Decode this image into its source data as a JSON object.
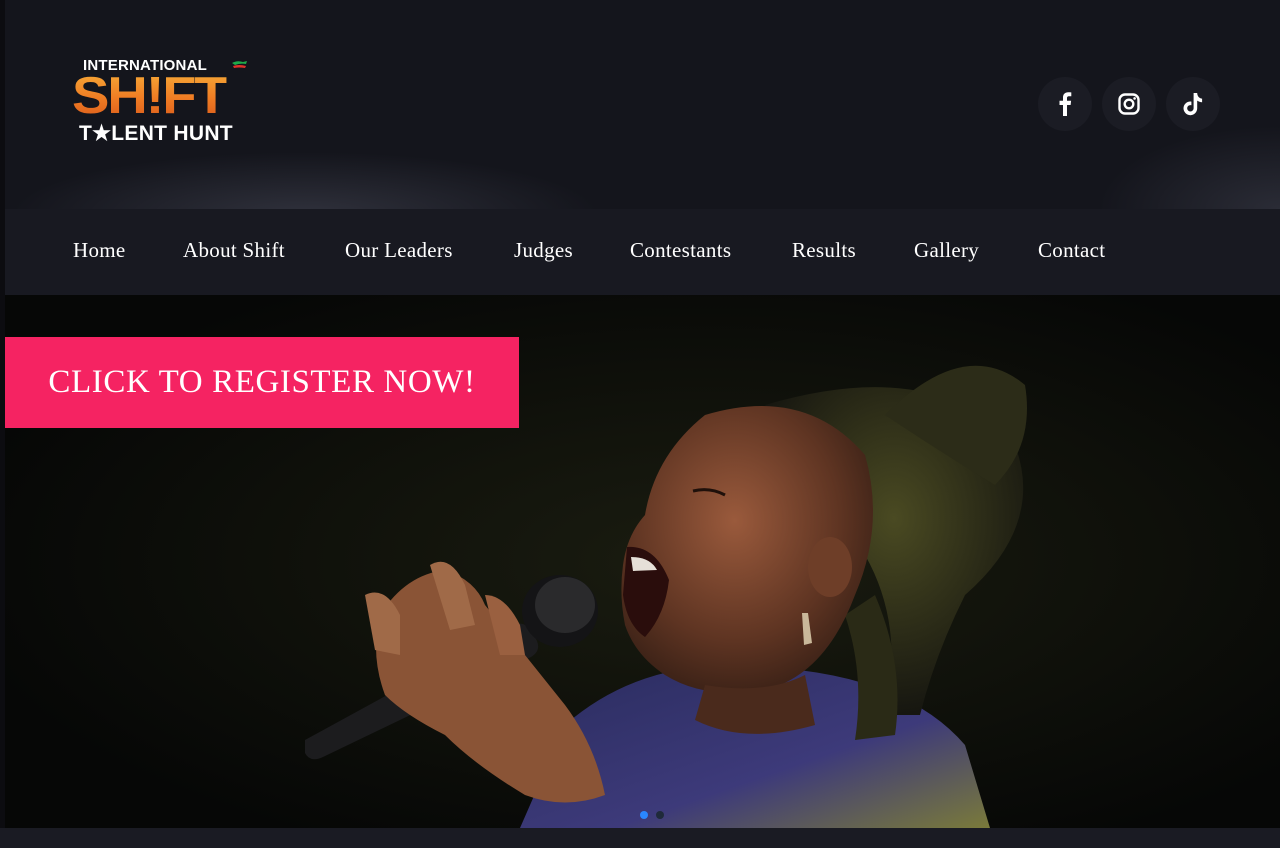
{
  "logo": {
    "top_text": "INTERNATIONAL",
    "main_text": "SH!FT",
    "bottom_text": "T★LENT HUNT"
  },
  "socials": [
    {
      "icon": "facebook-icon"
    },
    {
      "icon": "instagram-icon"
    },
    {
      "icon": "tiktok-icon"
    }
  ],
  "nav": {
    "items": [
      "Home",
      "About Shift",
      "Our Leaders",
      "Judges",
      "Contestants",
      "Results",
      "Gallery",
      "Contact"
    ]
  },
  "hero": {
    "cta_label": "CLICK TO REGISTER NOW!",
    "image": "singer-on-stage-photo",
    "slides": 2,
    "active_slide": 1
  },
  "colors": {
    "cta": "#f52362",
    "background": "#15161d",
    "nav": "#181921",
    "active_dot": "#2a86ff"
  }
}
